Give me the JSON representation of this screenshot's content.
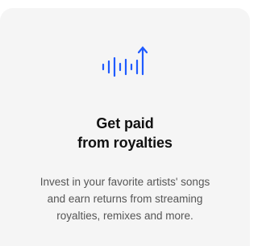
{
  "card": {
    "icon": "sound-wave-arrow-up-icon",
    "title_line1": "Get paid",
    "title_line2": "from royalties",
    "description_line1": "Invest in your favorite artists' songs",
    "description_line2": "and earn returns from streaming",
    "description_line3": "royalties, remixes and more."
  },
  "colors": {
    "accent": "#1f5bff",
    "card_background": "#f5f5f5",
    "title": "#111111",
    "description": "#555555"
  }
}
